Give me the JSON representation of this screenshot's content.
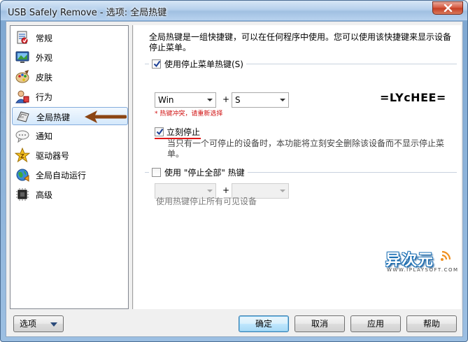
{
  "window": {
    "title": "USB Safely Remove - 选项: 全局热键"
  },
  "sidebar": {
    "items": [
      {
        "label": "常规",
        "icon": "general-settings-icon"
      },
      {
        "label": "外观",
        "icon": "appearance-icon"
      },
      {
        "label": "皮肤",
        "icon": "skin-palette-icon"
      },
      {
        "label": "行为",
        "icon": "behavior-user-icon"
      },
      {
        "label": "全局热键",
        "icon": "hotkey-keyboard-icon"
      },
      {
        "label": "通知",
        "icon": "notification-cloud-icon"
      },
      {
        "label": "驱动器号",
        "icon": "drive-letter-star-icon"
      },
      {
        "label": "全局自动运行",
        "icon": "autorun-globe-icon"
      },
      {
        "label": "高级",
        "icon": "advanced-chip-icon"
      }
    ],
    "selected_index": 4
  },
  "content": {
    "description": "全局热键是一组快捷键，可以在任何程序中使用。您可以使用该快捷键来显示设备停止菜单。",
    "stop_menu_group": {
      "label": "使用停止菜单热键(S)",
      "checked": true,
      "modifier_value": "Win",
      "key_value": "S",
      "plus": "+",
      "error": "* 热键冲突，请重新选择"
    },
    "brand_text": "=LYcHEE=",
    "instant_stop": {
      "label": "立刻停止",
      "checked": true,
      "description": "当只有一个可停止的设备时，本功能将立刻安全删除该设备而不显示停止菜单。"
    },
    "stop_all_group": {
      "label": "使用 \"停止全部\" 热键",
      "checked": false,
      "modifier_value": "",
      "key_value": "",
      "plus": "+",
      "hint": "使用热键停止所有可见设备"
    },
    "watermark": {
      "cn": "异次元",
      "en": "WWW.IPLAYSOFT.COM"
    }
  },
  "footer": {
    "options_button": "选项",
    "ok_button": "确定",
    "cancel_button": "取消",
    "apply_button": "应用",
    "help_button": "帮助"
  },
  "colors": {
    "error": "#d01010",
    "arrow": "#8b4513",
    "selection_border": "#84acdd"
  }
}
